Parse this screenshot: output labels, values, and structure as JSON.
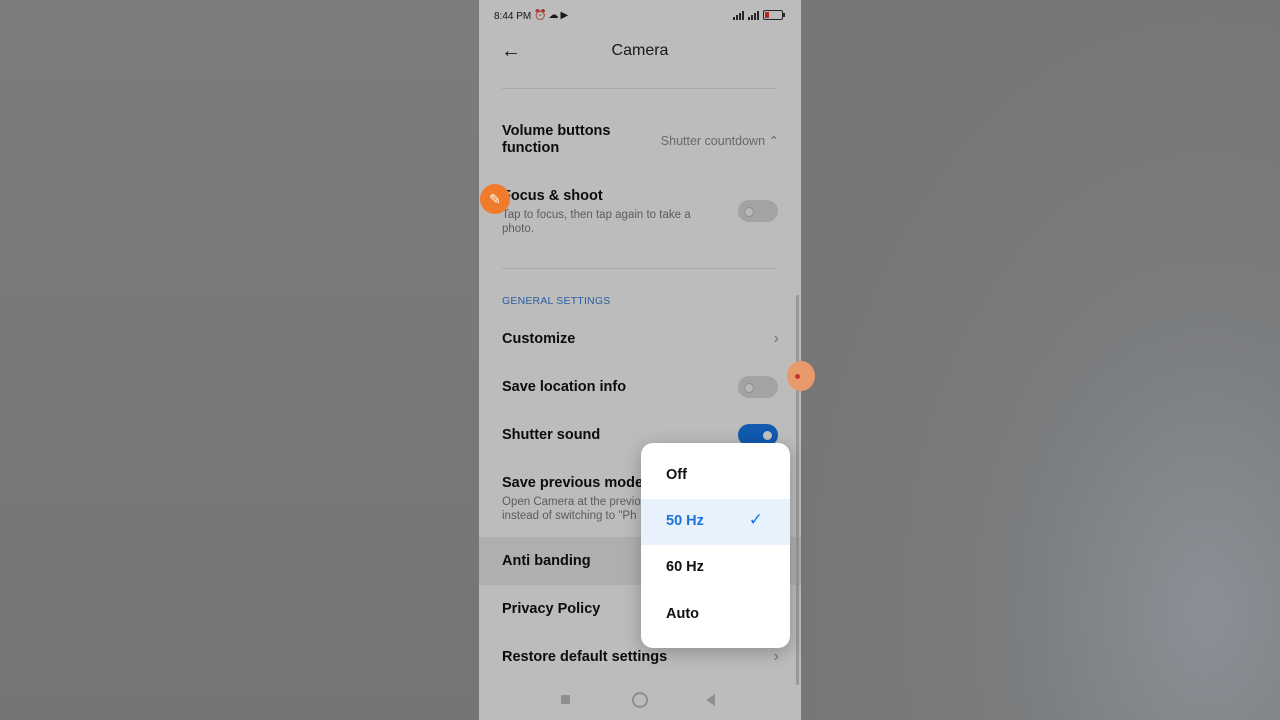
{
  "status_bar": {
    "time": "8:44 PM",
    "icons": [
      "alarm-icon",
      "cloud-icon",
      "video-icon"
    ]
  },
  "header": {
    "title": "Camera"
  },
  "settings": {
    "volume_buttons": {
      "label": "Volume buttons function",
      "value": "Shutter countdown"
    },
    "focus_shoot": {
      "label": "Focus & shoot",
      "sub": "Tap to focus, then tap again to take a photo.",
      "enabled": false
    },
    "section_general": "GENERAL SETTINGS",
    "customize": {
      "label": "Customize"
    },
    "save_location": {
      "label": "Save location info",
      "enabled": false
    },
    "shutter_sound": {
      "label": "Shutter sound",
      "enabled": true
    },
    "save_previous_mode": {
      "label": "Save previous mode",
      "sub_line1": "Open Camera at the previo",
      "sub_line2": "instead of switching to \"Ph"
    },
    "anti_banding": {
      "label": "Anti banding"
    },
    "privacy_policy": {
      "label": "Privacy Policy"
    },
    "restore_defaults": {
      "label": "Restore default settings"
    }
  },
  "popup": {
    "options": [
      {
        "label": "Off",
        "selected": false
      },
      {
        "label": "50 Hz",
        "selected": true
      },
      {
        "label": "60 Hz",
        "selected": false
      },
      {
        "label": "Auto",
        "selected": false
      }
    ],
    "selected_color": "#1a73d9"
  },
  "colors": {
    "accent": "#1677e6",
    "section": "#3a7bd5"
  }
}
